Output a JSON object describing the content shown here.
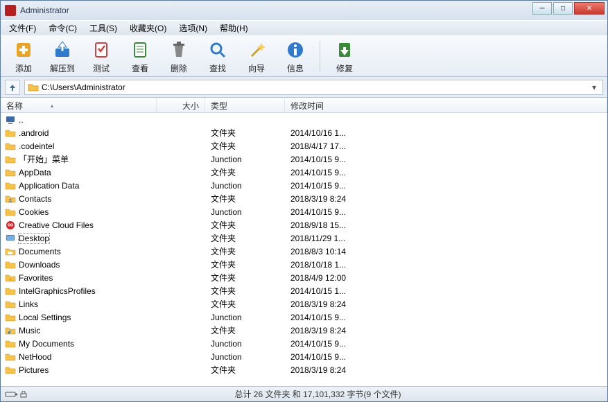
{
  "titlebar": {
    "title": "Administrator"
  },
  "menu": {
    "items": [
      "文件(F)",
      "命令(C)",
      "工具(S)",
      "收藏夹(O)",
      "选项(N)",
      "帮助(H)"
    ]
  },
  "toolbar": {
    "items": [
      {
        "label": "添加",
        "icon": "add"
      },
      {
        "label": "解压到",
        "icon": "extract"
      },
      {
        "label": "测试",
        "icon": "test"
      },
      {
        "label": "查看",
        "icon": "view"
      },
      {
        "label": "删除",
        "icon": "delete"
      },
      {
        "label": "查找",
        "icon": "find"
      },
      {
        "label": "向导",
        "icon": "wizard"
      },
      {
        "label": "信息",
        "icon": "info"
      },
      {
        "label": "修复",
        "icon": "repair"
      }
    ]
  },
  "address": {
    "path": "C:\\Users\\Administrator"
  },
  "columns": {
    "name": "名称",
    "size": "大小",
    "type": "类型",
    "mtime": "修改时间"
  },
  "files": [
    {
      "name": "..",
      "icon": "computer",
      "type": "",
      "mtime": ""
    },
    {
      "name": ".android",
      "icon": "folder",
      "type": "文件夹",
      "mtime": "2014/10/16 1..."
    },
    {
      "name": ".codeintel",
      "icon": "folder",
      "type": "文件夹",
      "mtime": "2018/4/17 17..."
    },
    {
      "name": "「开始」菜单",
      "icon": "folder",
      "type": "Junction",
      "mtime": "2014/10/15 9..."
    },
    {
      "name": "AppData",
      "icon": "folder",
      "type": "文件夹",
      "mtime": "2014/10/15 9..."
    },
    {
      "name": "Application Data",
      "icon": "folder",
      "type": "Junction",
      "mtime": "2014/10/15 9..."
    },
    {
      "name": "Contacts",
      "icon": "contacts",
      "type": "文件夹",
      "mtime": "2018/3/19 8:24"
    },
    {
      "name": "Cookies",
      "icon": "folder",
      "type": "Junction",
      "mtime": "2014/10/15 9..."
    },
    {
      "name": "Creative Cloud Files",
      "icon": "cc",
      "type": "文件夹",
      "mtime": "2018/9/18 15..."
    },
    {
      "name": "Desktop",
      "icon": "desktop",
      "type": "文件夹",
      "mtime": "2018/11/29 1...",
      "selected": true
    },
    {
      "name": "Documents",
      "icon": "docs",
      "type": "文件夹",
      "mtime": "2018/8/3 10:14"
    },
    {
      "name": "Downloads",
      "icon": "folder",
      "type": "文件夹",
      "mtime": "2018/10/18 1..."
    },
    {
      "name": "Favorites",
      "icon": "fav",
      "type": "文件夹",
      "mtime": "2018/4/9 12:00"
    },
    {
      "name": "IntelGraphicsProfiles",
      "icon": "folder",
      "type": "文件夹",
      "mtime": "2014/10/15 1..."
    },
    {
      "name": "Links",
      "icon": "folder",
      "type": "文件夹",
      "mtime": "2018/3/19 8:24"
    },
    {
      "name": "Local Settings",
      "icon": "folder",
      "type": "Junction",
      "mtime": "2014/10/15 9..."
    },
    {
      "name": "Music",
      "icon": "music",
      "type": "文件夹",
      "mtime": "2018/3/19 8:24"
    },
    {
      "name": "My Documents",
      "icon": "folder",
      "type": "Junction",
      "mtime": "2014/10/15 9..."
    },
    {
      "name": "NetHood",
      "icon": "folder",
      "type": "Junction",
      "mtime": "2014/10/15 9..."
    },
    {
      "name": "Pictures",
      "icon": "folder",
      "type": "文件夹",
      "mtime": "2018/3/19 8:24"
    }
  ],
  "status": {
    "text": "总计 26 文件夹 和 17,101,332 字节(9 个文件)"
  }
}
